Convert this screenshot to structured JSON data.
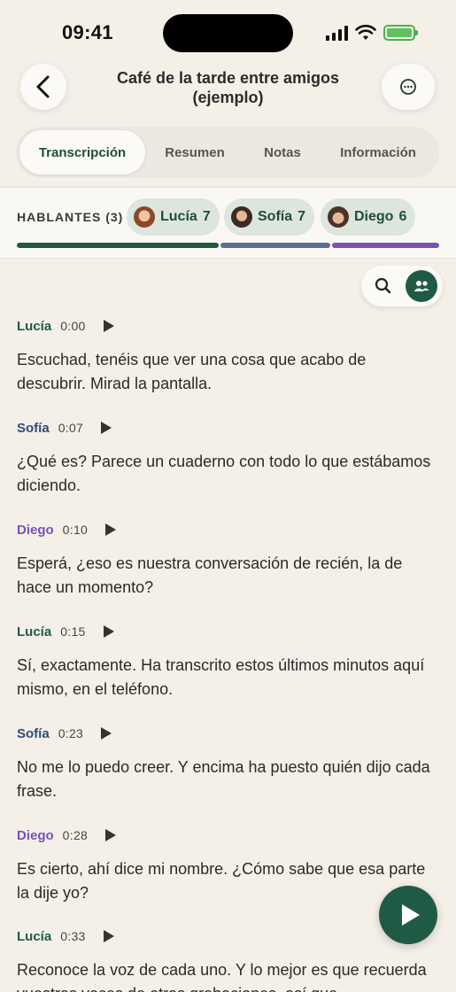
{
  "status": {
    "time": "09:41"
  },
  "header": {
    "title": "Café de la tarde entre amigos (ejemplo)"
  },
  "tabs": [
    {
      "label": "Transcripción",
      "active": true
    },
    {
      "label": "Resumen",
      "active": false
    },
    {
      "label": "Notas",
      "active": false
    },
    {
      "label": "Información",
      "active": false
    }
  ],
  "speakers": {
    "label": "HABLANTES (3)",
    "list": [
      {
        "name": "Lucía",
        "count": "7",
        "color": "#1f5a45"
      },
      {
        "name": "Sofía",
        "count": "7",
        "color": "#5a6f8e"
      },
      {
        "name": "Diego",
        "count": "6",
        "color": "#7a52b3"
      }
    ],
    "share": [
      0.4823,
      0.2634,
      0.2543
    ]
  },
  "icons": {
    "back": "chevron-left-icon",
    "more": "ellipsis-circle-icon",
    "search": "search-icon",
    "people": "people-icon",
    "play": "play-icon"
  },
  "transcript": [
    {
      "speaker": "Lucía",
      "time": "0:00",
      "color": "#1f5a45",
      "text": "Escuchad, tenéis que ver una cosa que acabo de descubrir. Mirad la pantalla."
    },
    {
      "speaker": "Sofía",
      "time": "0:07",
      "color": "#2f4c7a",
      "text": "¿Qué es? Parece un cuaderno con todo lo que estábamos diciendo."
    },
    {
      "speaker": "Diego",
      "time": "0:10",
      "color": "#7a52b3",
      "text": "Esperá, ¿eso es nuestra conversación de recién, la de hace un momento?"
    },
    {
      "speaker": "Lucía",
      "time": "0:15",
      "color": "#1f5a45",
      "text": "Sí, exactamente. Ha transcrito estos últimos minutos aquí mismo, en el teléfono."
    },
    {
      "speaker": "Sofía",
      "time": "0:23",
      "color": "#2f4c7a",
      "text": "No me lo puedo creer. Y encima ha puesto quién dijo cada frase."
    },
    {
      "speaker": "Diego",
      "time": "0:28",
      "color": "#7a52b3",
      "text": "Es cierto, ahí dice mi nombre. ¿Cómo sabe que esa parte la dije yo?"
    },
    {
      "speaker": "Lucía",
      "time": "0:33",
      "color": "#1f5a45",
      "text": "Reconoce la voz de cada uno. Y lo mejor es que recuerda vuestras voces de otras grabaciones, así que"
    }
  ]
}
